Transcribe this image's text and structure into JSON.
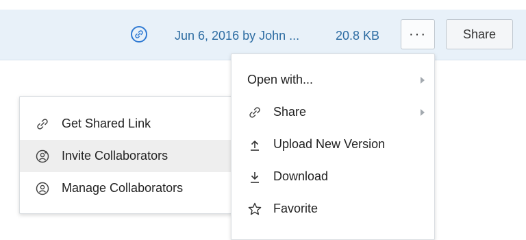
{
  "file": {
    "modified": "Jun 6, 2016 by John ...",
    "size": "20.8 KB",
    "more_label": "···",
    "share_label": "Share",
    "link_icon": "link-icon"
  },
  "main_menu": {
    "items": [
      {
        "label": "Open with...",
        "icon": "",
        "submenu": true
      },
      {
        "label": "Share",
        "icon": "link-icon",
        "submenu": true
      },
      {
        "label": "Upload New Version",
        "icon": "upload-icon",
        "submenu": false
      },
      {
        "label": "Download",
        "icon": "download-icon",
        "submenu": false
      },
      {
        "label": "Favorite",
        "icon": "star-icon",
        "submenu": false
      }
    ]
  },
  "share_submenu": {
    "items": [
      {
        "label": "Get Shared Link",
        "icon": "link-icon"
      },
      {
        "label": "Invite Collaborators",
        "icon": "add-person-icon",
        "highlighted": true
      },
      {
        "label": "Manage Collaborators",
        "icon": "person-icon"
      }
    ]
  },
  "colors": {
    "accent": "#2f7ad3",
    "meta_text": "#2d6ca2",
    "row_background": "#e8f1f9",
    "hover": "#eeeeee"
  }
}
